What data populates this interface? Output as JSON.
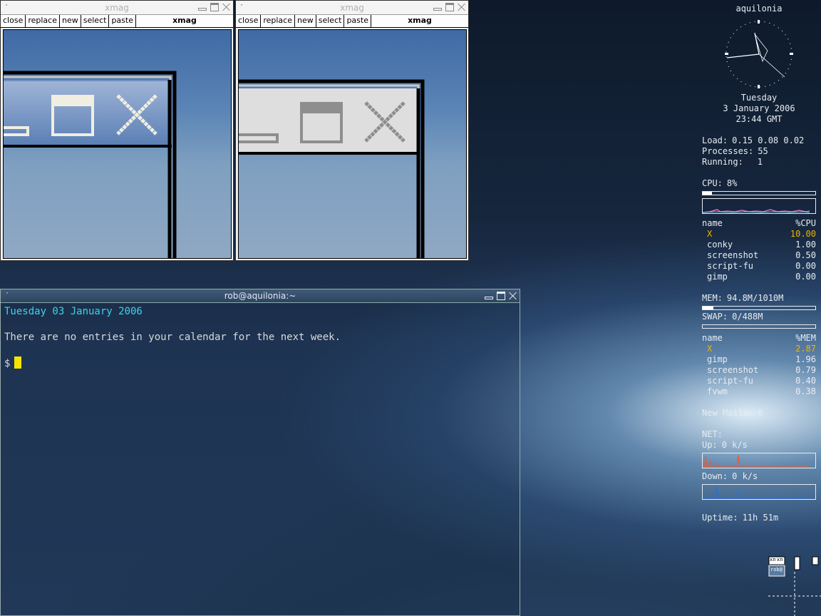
{
  "xmag_windows": [
    {
      "title": "xmag",
      "menu": [
        "close",
        "replace",
        "new",
        "select",
        "paste"
      ],
      "name": "xmag"
    },
    {
      "title": "xmag",
      "menu": [
        "close",
        "replace",
        "new",
        "select",
        "paste"
      ],
      "name": "xmag"
    }
  ],
  "terminal": {
    "title": "rob@aquilonia:~",
    "date_line": "Tuesday 03 January 2006",
    "message": "There are no entries in your calendar for the next week.",
    "prompt": "$"
  },
  "conky": {
    "hostname": "aquilonia",
    "day": "Tuesday",
    "date": "3 January 2006",
    "time": "23:44 GMT",
    "load_label": "Load:",
    "load_value": "0.15 0.08 0.02",
    "processes_label": "Processes:",
    "processes_value": "55",
    "running_label": "Running:",
    "running_value": "1",
    "cpu_label": "CPU:",
    "cpu_value": "8%",
    "cpu_fraction": 0.08,
    "cpu_table": {
      "header": [
        "name",
        "%CPU"
      ],
      "rows": [
        [
          "X",
          "10.00"
        ],
        [
          "conky",
          "1.00"
        ],
        [
          "screenshot",
          "0.50"
        ],
        [
          "script-fu",
          "0.00"
        ],
        [
          "gimp",
          "0.00"
        ]
      ]
    },
    "mem_label": "MEM:",
    "mem_value": "94.8M/1010M",
    "mem_fraction": 0.094,
    "swap_label": "SWAP:",
    "swap_value": "0/488M",
    "swap_fraction": 0,
    "mem_table": {
      "header": [
        "name",
        "%MEM"
      ],
      "rows": [
        [
          "X",
          "2.87"
        ],
        [
          "gimp",
          "1.96"
        ],
        [
          "screenshot",
          "0.79"
        ],
        [
          "script-fu",
          "0.40"
        ],
        [
          "fvwm",
          "0.38"
        ]
      ]
    },
    "mails_label": "New Mails:",
    "mails_value": "0",
    "net_label": "NET:",
    "up_label": "Up:",
    "up_value": "0 k/s",
    "down_label": "Down:",
    "down_value": "0 k/s",
    "uptime_label": "Uptime:",
    "uptime_value": "11h 51m"
  },
  "pager": {
    "labels": [
      "xn",
      "xn",
      "rob@"
    ]
  },
  "colors": {
    "terminal_date": "#3cd4e8",
    "cursor": "#f4e400",
    "highlight": "#f0b400"
  }
}
